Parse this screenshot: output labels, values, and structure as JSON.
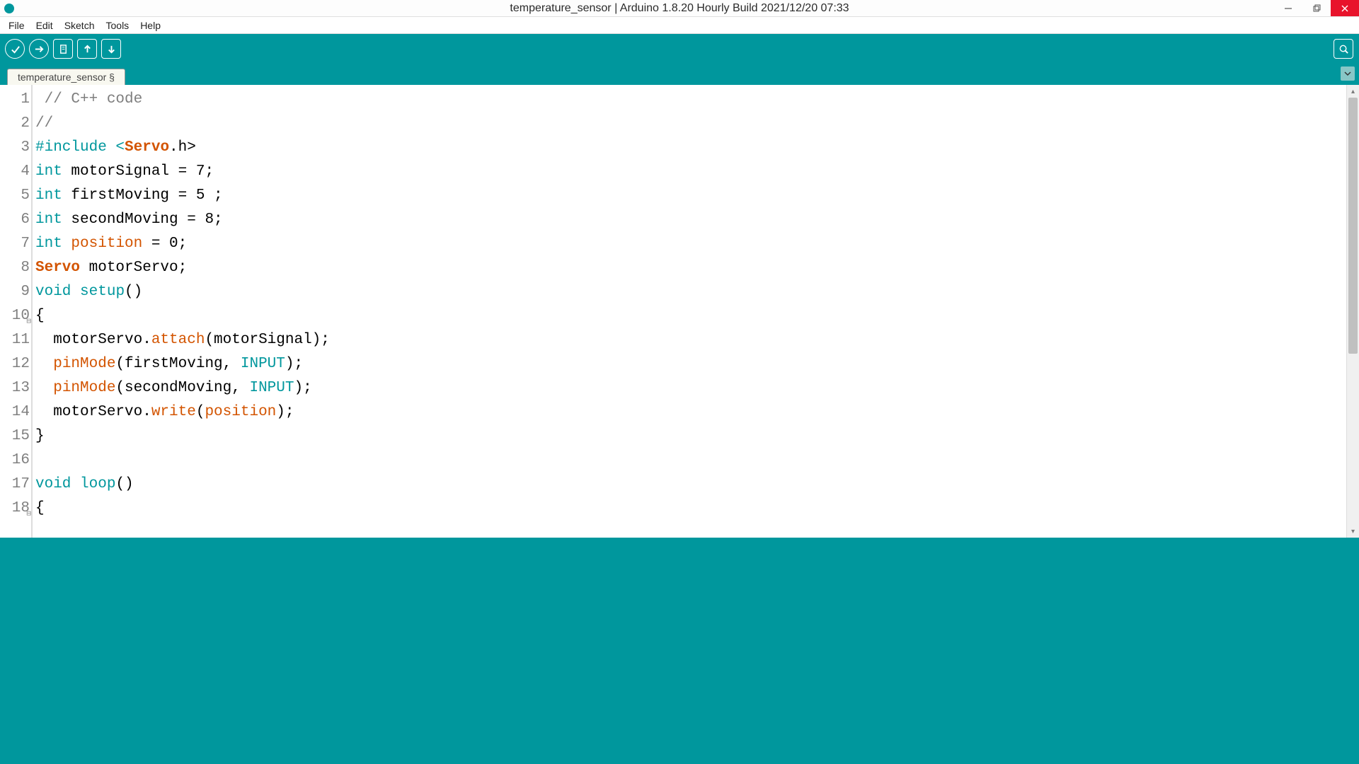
{
  "window": {
    "title": "temperature_sensor | Arduino 1.8.20 Hourly Build 2021/12/20 07:33"
  },
  "menu": {
    "file": "File",
    "edit": "Edit",
    "sketch": "Sketch",
    "tools": "Tools",
    "help": "Help"
  },
  "tab": {
    "name": "temperature_sensor §"
  },
  "code": {
    "lines": [
      {
        "n": 1,
        "fold": "",
        "tokens": [
          {
            "t": " // C++ code",
            "c": "c-comment"
          }
        ]
      },
      {
        "n": 2,
        "fold": "",
        "tokens": [
          {
            "t": "//",
            "c": "c-comment"
          }
        ]
      },
      {
        "n": 3,
        "fold": "",
        "tokens": [
          {
            "t": "#include <",
            "c": "c-keyword"
          },
          {
            "t": "Servo",
            "c": "c-class"
          },
          {
            "t": ".h>",
            "c": ""
          }
        ]
      },
      {
        "n": 4,
        "fold": "",
        "tokens": [
          {
            "t": "int",
            "c": "c-keyword"
          },
          {
            "t": " motorSignal = 7;",
            "c": ""
          }
        ]
      },
      {
        "n": 5,
        "fold": "",
        "tokens": [
          {
            "t": "int",
            "c": "c-keyword"
          },
          {
            "t": " firstMoving = 5 ;",
            "c": ""
          }
        ]
      },
      {
        "n": 6,
        "fold": "",
        "tokens": [
          {
            "t": "int",
            "c": "c-keyword"
          },
          {
            "t": " secondMoving = 8;",
            "c": ""
          }
        ]
      },
      {
        "n": 7,
        "fold": "",
        "tokens": [
          {
            "t": "int",
            "c": "c-keyword"
          },
          {
            "t": " ",
            "c": ""
          },
          {
            "t": "position",
            "c": "c-var"
          },
          {
            "t": " = 0;",
            "c": ""
          }
        ]
      },
      {
        "n": 8,
        "fold": "",
        "tokens": [
          {
            "t": "Servo",
            "c": "c-class"
          },
          {
            "t": " motorServo;",
            "c": ""
          }
        ]
      },
      {
        "n": 9,
        "fold": "",
        "tokens": [
          {
            "t": "void",
            "c": "c-keyword"
          },
          {
            "t": " ",
            "c": ""
          },
          {
            "t": "setup",
            "c": "c-keyword"
          },
          {
            "t": "()",
            "c": ""
          }
        ]
      },
      {
        "n": 10,
        "fold": "⊟",
        "tokens": [
          {
            "t": "{",
            "c": ""
          }
        ]
      },
      {
        "n": 11,
        "fold": "",
        "tokens": [
          {
            "t": "  motorServo.",
            "c": ""
          },
          {
            "t": "attach",
            "c": "c-func"
          },
          {
            "t": "(motorSignal);",
            "c": ""
          }
        ]
      },
      {
        "n": 12,
        "fold": "",
        "tokens": [
          {
            "t": "  ",
            "c": ""
          },
          {
            "t": "pinMode",
            "c": "c-func"
          },
          {
            "t": "(firstMoving, ",
            "c": ""
          },
          {
            "t": "INPUT",
            "c": "c-const"
          },
          {
            "t": ");",
            "c": ""
          }
        ]
      },
      {
        "n": 13,
        "fold": "",
        "tokens": [
          {
            "t": "  ",
            "c": ""
          },
          {
            "t": "pinMode",
            "c": "c-func"
          },
          {
            "t": "(secondMoving, ",
            "c": ""
          },
          {
            "t": "INPUT",
            "c": "c-const"
          },
          {
            "t": ");",
            "c": ""
          }
        ]
      },
      {
        "n": 14,
        "fold": "",
        "tokens": [
          {
            "t": "  motorServo.",
            "c": ""
          },
          {
            "t": "write",
            "c": "c-func"
          },
          {
            "t": "(",
            "c": ""
          },
          {
            "t": "position",
            "c": "c-var"
          },
          {
            "t": ");",
            "c": ""
          }
        ]
      },
      {
        "n": 15,
        "fold": "",
        "tokens": [
          {
            "t": "}",
            "c": ""
          }
        ]
      },
      {
        "n": 16,
        "fold": "",
        "tokens": [
          {
            "t": "",
            "c": ""
          }
        ]
      },
      {
        "n": 17,
        "fold": "",
        "tokens": [
          {
            "t": "void",
            "c": "c-keyword"
          },
          {
            "t": " ",
            "c": ""
          },
          {
            "t": "loop",
            "c": "c-keyword"
          },
          {
            "t": "()",
            "c": ""
          }
        ]
      },
      {
        "n": 18,
        "fold": "⊟",
        "tokens": [
          {
            "t": "{",
            "c": ""
          }
        ]
      }
    ]
  }
}
